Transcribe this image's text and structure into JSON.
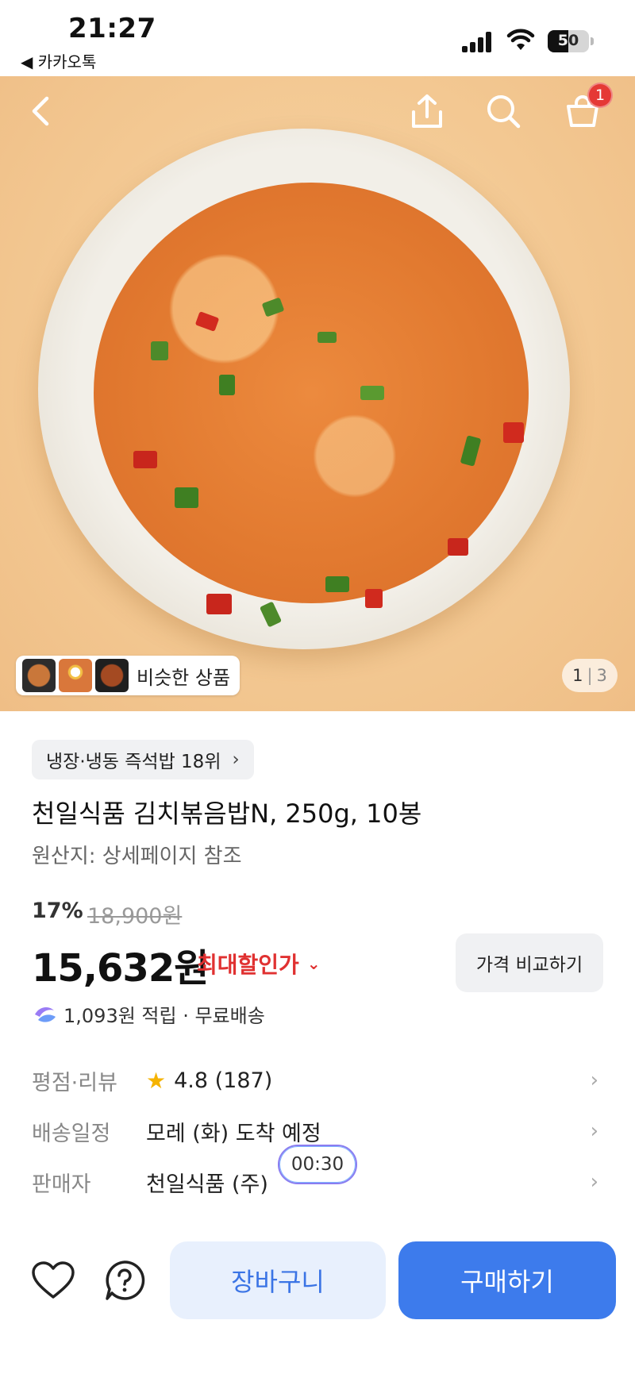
{
  "status_bar": {
    "time": "21:27",
    "back_app": "◀ 카카오톡",
    "battery": "50",
    "battery_level": 0.5
  },
  "hero": {
    "cart_badge": "1",
    "similar_label": "비슷한 상품",
    "page_current": "1",
    "page_separator": "|",
    "page_total": "3"
  },
  "product": {
    "rank": "냉장·냉동 즉석밥 18위",
    "title": "천일식품 김치볶음밥N, 250g, 10봉",
    "origin": "원산지: 상세페이지 참조",
    "discount": "17%",
    "original_price": "18,900원",
    "price": "15,632원",
    "max_discount": "최대할인가",
    "compare_button": "가격 비교하기",
    "points": "1,093원 적립 · 무료배송"
  },
  "info_rows": [
    {
      "label": "평점·리뷰",
      "value": "4.8 (187)"
    },
    {
      "label": "배송일정",
      "value": "모레 (화) 도착 예정"
    },
    {
      "label": "판매자",
      "value": "천일식품 (주)"
    }
  ],
  "timer": "00:30",
  "bottom_bar": {
    "cart_label": "장바구니",
    "buy_label": "구매하기"
  },
  "icons": {
    "back": "back-icon",
    "share": "share-icon",
    "search": "search-icon",
    "cart": "cart-icon",
    "heart": "heart-icon",
    "help": "help-icon",
    "star": "star-icon",
    "points": "points-icon"
  },
  "colors": {
    "accent_blue": "#3d7bec",
    "discount_red": "#e03131",
    "star_yellow": "#f5b301",
    "badge_red": "#e53935"
  }
}
